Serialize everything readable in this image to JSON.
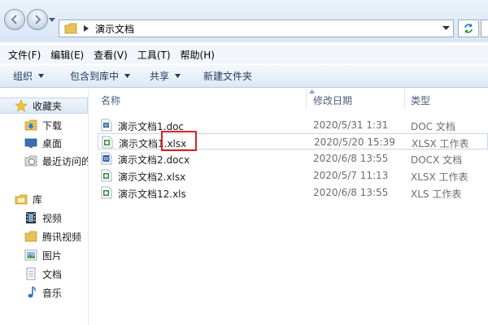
{
  "address": {
    "path_segment": "演示文档"
  },
  "menu": [
    "文件(F)",
    "编辑(E)",
    "查看(V)",
    "工具(T)",
    "帮助(H)"
  ],
  "commands": {
    "organize": "组织",
    "include_in_library": "包含到库中",
    "share": "共享",
    "new_folder": "新建文件夹"
  },
  "nav": {
    "favorites": "收藏夹",
    "downloads": "下载",
    "desktop": "桌面",
    "recent": "最近访问的位置",
    "libraries": "库",
    "videos": "视频",
    "tencent_video": "腾讯视频",
    "pictures": "图片",
    "documents": "文档",
    "music": "音乐"
  },
  "columns": {
    "name": "名称",
    "modified": "修改日期",
    "type": "类型"
  },
  "files": [
    {
      "name": "演示文档1.doc",
      "modified": "2020/5/31 1:31",
      "type": "DOC 文档",
      "icon": "word-doc-icon"
    },
    {
      "name": "演示文档1.xlsx",
      "modified": "2020/5/20 15:39",
      "type": "XLSX 工作表",
      "icon": "excel-icon"
    },
    {
      "name": "演示文档2.docx",
      "modified": "2020/6/8 13:55",
      "type": "DOCX 文档",
      "icon": "word-icon"
    },
    {
      "name": "演示文档2.xlsx",
      "modified": "2020/5/7 11:13",
      "type": "XLSX 工作表",
      "icon": "excel-icon"
    },
    {
      "name": "演示文档12.xls",
      "modified": "2020/6/8 13:55",
      "type": "XLS 工作表",
      "icon": "excel-icon"
    }
  ],
  "colors": {
    "highlight": "#e02020",
    "command_text": "#1e395b",
    "excel_green": "#2f8f3a",
    "word_blue": "#2a5ca8"
  }
}
